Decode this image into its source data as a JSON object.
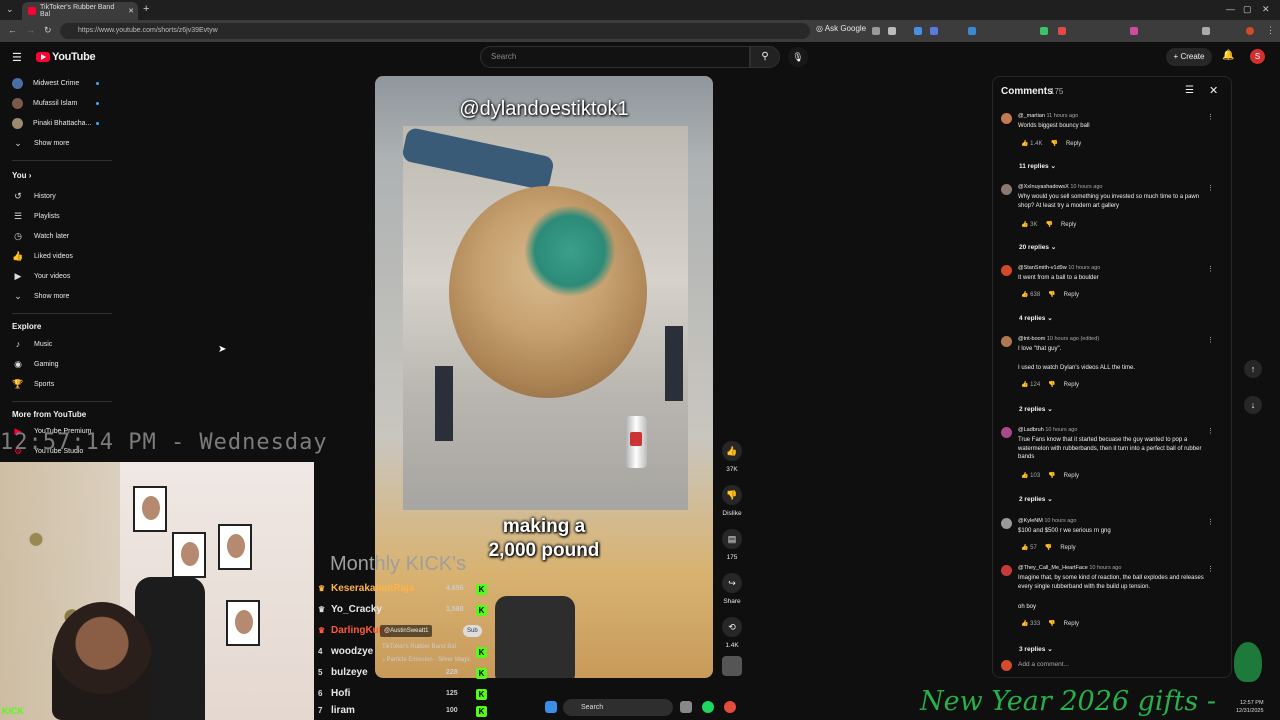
{
  "browser": {
    "tab_title": "TikToker's Rubber Band Bal",
    "url": "https://www.youtube.com/shorts/z6jv39Evtyw",
    "ask_google": "Ask Google",
    "new_tab": "+"
  },
  "header": {
    "logo_text": "YouTube",
    "search_placeholder": "Search",
    "create_label": "Create",
    "avatar_letter": "S"
  },
  "sidebar": {
    "subscriptions": [
      {
        "label": "Midwest Crime",
        "color": "#4a6fa5"
      },
      {
        "label": "Mufassil Islam",
        "color": "#7a5a48"
      },
      {
        "label": "Pinaki Bhattacha...",
        "color": "#9a8a70"
      }
    ],
    "show_more_1": "Show more",
    "you_heading": "You",
    "you_items": [
      {
        "label": "History",
        "icon": "history-icon"
      },
      {
        "label": "Playlists",
        "icon": "playlists-icon"
      },
      {
        "label": "Watch later",
        "icon": "watch-later-icon"
      },
      {
        "label": "Liked videos",
        "icon": "liked-videos-icon"
      },
      {
        "label": "Your videos",
        "icon": "your-videos-icon"
      }
    ],
    "show_more_2": "Show more",
    "explore_heading": "Explore",
    "explore_items": [
      {
        "label": "Music",
        "icon": "music-icon"
      },
      {
        "label": "Gaming",
        "icon": "gaming-icon"
      },
      {
        "label": "Sports",
        "icon": "sports-icon"
      }
    ],
    "more_heading": "More from YouTube",
    "more_items": [
      {
        "label": "YouTube Premium"
      },
      {
        "label": "YouTube Studio"
      }
    ]
  },
  "video": {
    "watermark": "@dylandoestiktok1",
    "caption_line1": "making a",
    "caption_line2": "2,000 pound"
  },
  "actions": {
    "like_count": "37K",
    "dislike_label": "Dislike",
    "comment_count": "175",
    "share_label": "Share",
    "remix_count": "1.4K"
  },
  "comments": {
    "title": "Comments",
    "count": "175",
    "items": [
      {
        "user": "@_martian",
        "time": "11 hours ago",
        "text": "Worlds biggest bouncy ball",
        "likes": "1.4K",
        "replies": "11 replies",
        "avatar": "#c47a50"
      },
      {
        "user": "@XxInuyashadowsX",
        "time": "10 hours ago",
        "text": "Why would you sell something you invested so much time to a pawn shop? At least try a modern art gallery",
        "likes": "3K",
        "replies": "20 replies",
        "avatar": "#8a7a70"
      },
      {
        "user": "@StanSmith-v1d9w",
        "time": "10 hours ago",
        "text": "It went from a ball to a boulder",
        "likes": "638",
        "replies": "4 replies",
        "avatar": "#d04a2a"
      },
      {
        "user": "@tnt-boom",
        "time": "10 hours ago (edited)",
        "text": "I love \"that guy\".",
        "text2": "I used to watch Dylan's videos ALL the time.",
        "likes": "124",
        "replies": "2 replies",
        "avatar": "#b07850"
      },
      {
        "user": "@Ladbruh",
        "time": "10 hours ago",
        "text": "True Fans know that it started becuase the guy wanted to pop a watermelon with rubberbands, then it turn into a perfect ball of rubber bands",
        "likes": "103",
        "replies": "2 replies",
        "avatar": "#a84a8a"
      },
      {
        "user": "@KyleNM",
        "time": "10 hours ago",
        "text": "$100 and $500 r we serious rn gng",
        "likes": "57",
        "replies": "",
        "avatar": "#9a9a9a"
      },
      {
        "user": "@They_Call_Me_HeartFace",
        "time": "10 hours ago",
        "text": "Imagine that, by some kind of reaction, the ball explodes and releases every single rubberband with the build up tension.",
        "text2": "oh boy",
        "likes": "333",
        "replies": "3 replies",
        "avatar": "#c83a3a"
      }
    ],
    "reply_label": "Reply",
    "add_placeholder": "Add a comment..."
  },
  "overlay": {
    "clock": "12:57:14 PM - Wednesday",
    "kick_logo": "KICK",
    "monthly_title": "Monthly KICK's",
    "leaderboard": [
      {
        "rank": "",
        "name": "KeserakahanRaja",
        "amount": "4,656",
        "color": "#ffb347"
      },
      {
        "rank": "",
        "name": "Yo_Cracky",
        "amount": "1,588",
        "color": "#e8e8e8"
      },
      {
        "rank": "",
        "name": "DarlingKuro",
        "amount": "",
        "color": "#ff5a3a"
      },
      {
        "rank": "4",
        "name": "woodzye",
        "amount": "",
        "color": "#e8e8e8"
      },
      {
        "rank": "5",
        "name": "bulzeye",
        "amount": "228",
        "color": "#e8e8e8"
      },
      {
        "rank": "6",
        "name": "Hofi",
        "amount": "125",
        "color": "#e8e8e8"
      },
      {
        "rank": "7",
        "name": "liram",
        "amount": "100",
        "color": "#e8e8e8"
      }
    ],
    "tag_user": "@AustinSweatt1",
    "sub_chip": "Sub",
    "now_playing_1": "TikToker's Rubber Band Bal",
    "now_playing_2": "Particle Emission - Silver Magic",
    "banner": "New Year 2026 gifts -"
  },
  "taskbar": {
    "search_label": "Search",
    "time": "12:57 PM",
    "date": "12/31/2025"
  }
}
